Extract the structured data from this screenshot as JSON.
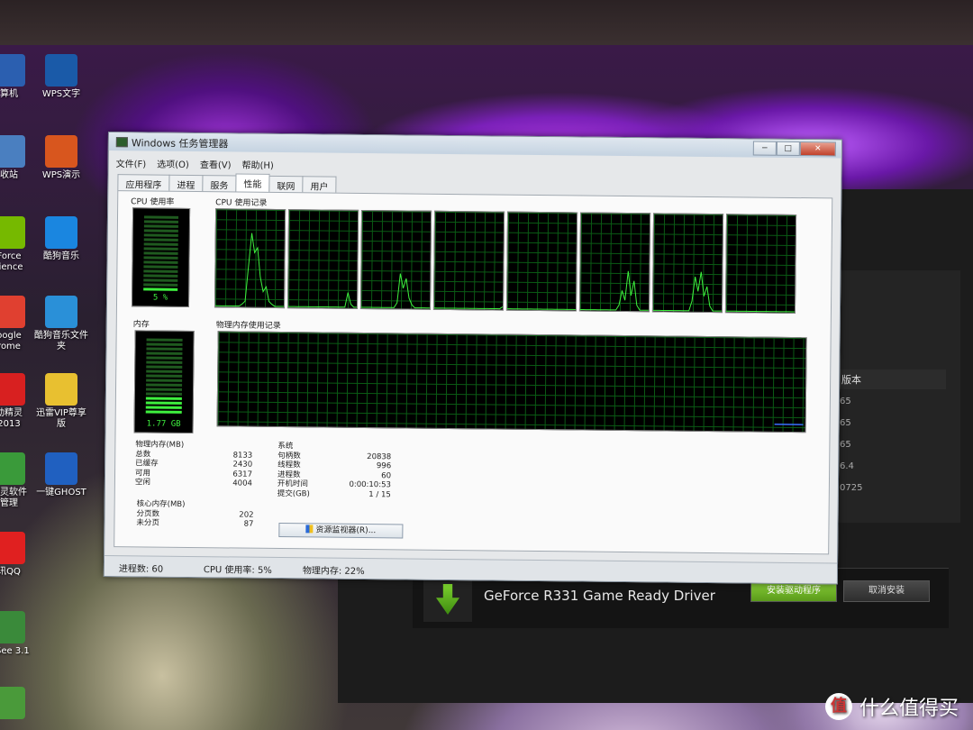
{
  "desktop": {
    "icons": [
      {
        "label": "算机",
        "color": "#2b5fb0"
      },
      {
        "label": "WPS文字",
        "color": "#1a5aa8"
      },
      {
        "label": "收站",
        "color": "#4a7fc0"
      },
      {
        "label": "WPS演示",
        "color": "#d8561e"
      },
      {
        "label": "Force\nrience",
        "color": "#76b900"
      },
      {
        "label": "酷狗音乐",
        "color": "#1a86e0"
      },
      {
        "label": "oogle\nrome",
        "color": "#e04030"
      },
      {
        "label": "酷狗音乐文件夹",
        "color": "#2a90d8"
      },
      {
        "label": "动精灵\n2013",
        "color": "#d82020"
      },
      {
        "label": "迅雷VIP尊享版",
        "color": "#e8c030"
      },
      {
        "label": "精灵软件\n管理",
        "color": "#3a9a3a"
      },
      {
        "label": "一键GHOST",
        "color": "#2060c0"
      },
      {
        "label": "讯QQ",
        "color": "#e02020"
      },
      {
        "label": "DSee 3.1",
        "color": "#3a8a3a"
      },
      {
        "label": "",
        "color": "#4a9a3a"
      }
    ]
  },
  "nvidia": {
    "column_header": "版本",
    "rows": [
      "65",
      "65",
      "65",
      "6.4",
      "0725"
    ],
    "title": "GeForce R331 Game Ready Driver",
    "install_label": "安装驱动程序",
    "cancel_label": "取消安装"
  },
  "taskmgr": {
    "title": "Windows 任务管理器",
    "window_buttons": {
      "min": "−",
      "max": "□",
      "close": "✕"
    },
    "menu": [
      "文件(F)",
      "选项(O)",
      "查看(V)",
      "帮助(H)"
    ],
    "tabs": [
      "应用程序",
      "进程",
      "服务",
      "性能",
      "联网",
      "用户"
    ],
    "active_tab": "性能",
    "cpu_usage_label": "CPU 使用率",
    "cpu_usage_value": "5 %",
    "cpu_usage_fraction": 0.05,
    "cpu_history_label": "CPU 使用记录",
    "cpu_history_cores": [
      [
        0,
        0,
        0,
        0,
        0,
        0,
        0,
        0,
        0,
        2,
        5,
        40,
        75,
        55,
        60,
        30,
        15,
        20,
        5,
        2,
        0,
        0,
        0,
        0
      ],
      [
        0,
        0,
        0,
        0,
        0,
        0,
        0,
        0,
        0,
        0,
        0,
        0,
        0,
        0,
        0,
        0,
        0,
        0,
        0,
        0,
        15,
        3,
        0,
        0
      ],
      [
        0,
        0,
        0,
        0,
        0,
        0,
        0,
        0,
        0,
        0,
        0,
        0,
        5,
        35,
        20,
        30,
        10,
        3,
        0,
        0,
        0,
        0,
        0,
        0
      ],
      [
        0,
        0,
        0,
        0,
        0,
        0,
        0,
        0,
        0,
        0,
        0,
        0,
        0,
        0,
        0,
        0,
        0,
        0,
        0,
        0,
        0,
        0,
        0,
        2
      ],
      [
        0,
        0,
        0,
        0,
        0,
        0,
        0,
        0,
        0,
        0,
        0,
        0,
        0,
        0,
        0,
        0,
        0,
        0,
        0,
        0,
        0,
        0,
        0,
        0
      ],
      [
        0,
        0,
        0,
        0,
        0,
        0,
        0,
        0,
        0,
        0,
        0,
        0,
        0,
        5,
        20,
        10,
        40,
        15,
        30,
        5,
        0,
        0,
        0,
        0
      ],
      [
        0,
        0,
        0,
        0,
        0,
        0,
        0,
        0,
        0,
        0,
        0,
        0,
        0,
        10,
        35,
        20,
        40,
        15,
        25,
        5,
        0,
        0,
        0,
        0
      ],
      [
        0,
        0,
        0,
        0,
        0,
        0,
        0,
        0,
        0,
        0,
        0,
        0,
        0,
        0,
        0,
        0,
        0,
        0,
        0,
        0,
        0,
        0,
        0,
        0
      ]
    ],
    "memory_label": "内存",
    "memory_value": "1.77 GB",
    "memory_fraction": 0.22,
    "memory_history_label": "物理内存使用记录",
    "memory_history_level": 0.22,
    "physical_memory": {
      "header": "物理内存(MB)",
      "rows": [
        {
          "label": "总数",
          "value": "8133"
        },
        {
          "label": "已缓存",
          "value": "2430"
        },
        {
          "label": "可用",
          "value": "6317"
        },
        {
          "label": "空闲",
          "value": "4004"
        }
      ]
    },
    "kernel_memory": {
      "header": "核心内存(MB)",
      "rows": [
        {
          "label": "分页数",
          "value": "202"
        },
        {
          "label": "未分页",
          "value": "87"
        }
      ]
    },
    "system": {
      "header": "系统",
      "rows": [
        {
          "label": "句柄数",
          "value": "20838"
        },
        {
          "label": "线程数",
          "value": "996"
        },
        {
          "label": "进程数",
          "value": "60"
        },
        {
          "label": "开机时间",
          "value": "0:00:10:53"
        },
        {
          "label": "提交(GB)",
          "value": "1 / 15"
        }
      ]
    },
    "resource_monitor_label": "资源监视器(R)...",
    "status": {
      "processes": "进程数: 60",
      "cpu": "CPU 使用率: 5%",
      "memory": "物理内存: 22%"
    }
  },
  "watermark": {
    "badge": "值",
    "text": "什么值得买"
  }
}
